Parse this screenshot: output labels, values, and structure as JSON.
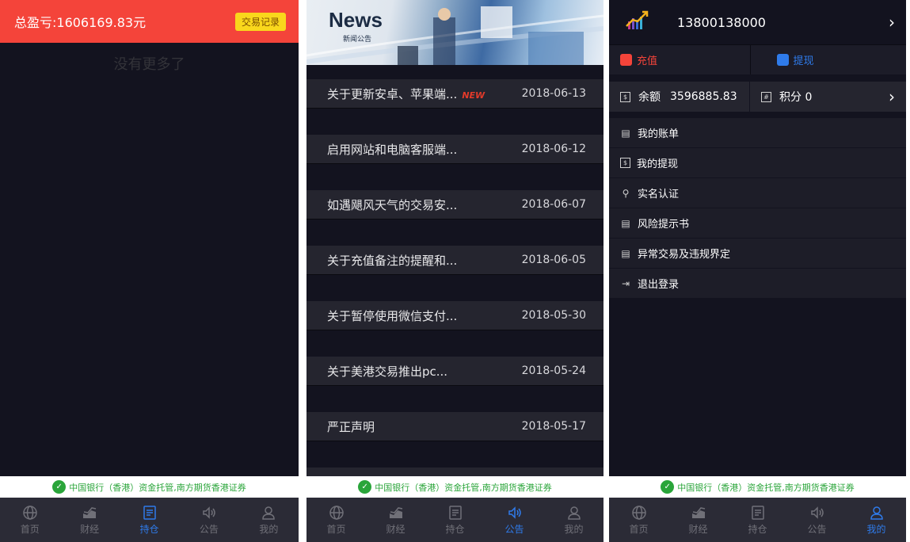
{
  "footer": {
    "custody_text": "中国银行（香港）资金托管,南方期货香港证券",
    "tabs": [
      "首页",
      "财经",
      "持仓",
      "公告",
      "我的"
    ]
  },
  "screen1": {
    "total_pl": "总盈亏:1606169.83元",
    "records_button": "交易记录",
    "no_more": "没有更多了"
  },
  "screen2": {
    "banner_title": "News",
    "banner_subtitle": "新闻公告",
    "new_badge": "NEW",
    "news": [
      {
        "title": "关于更新安卓、苹果端...",
        "date": "2018-06-13"
      },
      {
        "title": "启用网站和电脑客服端...",
        "date": "2018-06-12"
      },
      {
        "title": "如遇飓风天气的交易安...",
        "date": "2018-06-07"
      },
      {
        "title": "关于充值备注的提醒和...",
        "date": "2018-06-05"
      },
      {
        "title": "关于暂停使用微信支付...",
        "date": "2018-05-30"
      },
      {
        "title": "关于美港交易推出pc...",
        "date": "2018-05-24"
      },
      {
        "title": "严正声明",
        "date": "2018-05-17"
      }
    ]
  },
  "screen3": {
    "phone": "13800138000",
    "recharge": "充值",
    "withdraw": "提现",
    "balance_label": "余额",
    "balance_value": "3596885.83",
    "points": "积分 0",
    "menu": [
      "我的账单",
      "我的提现",
      "实名认证",
      "风险提示书",
      "异常交易及违规界定",
      "退出登录"
    ]
  },
  "colors": {
    "accent_red": "#f4443a",
    "accent_blue": "#2f7bea",
    "accent_yellow": "#f9d71c",
    "custody_green": "#2aa53a",
    "background": "#13131f"
  }
}
